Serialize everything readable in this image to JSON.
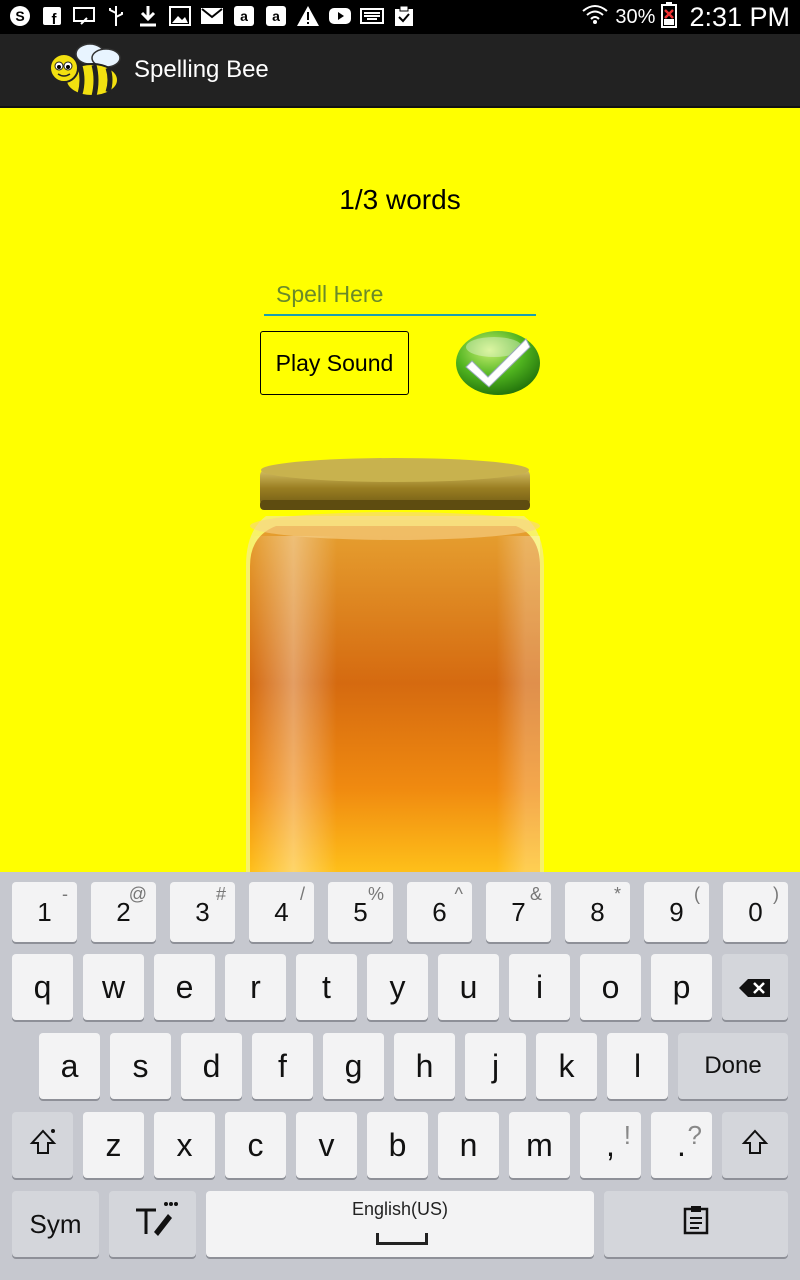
{
  "status_bar": {
    "icons": [
      "skype-icon",
      "facebook-icon",
      "cast-icon",
      "usb-icon",
      "download-icon",
      "gallery-icon",
      "gmail-icon",
      "amazon-icon",
      "amazon-icon",
      "warning-icon",
      "youtube-icon",
      "keyboard-icon",
      "clipboard-check-icon"
    ],
    "battery_percent": "30%",
    "time": "2:31 PM"
  },
  "app_bar": {
    "title": "Spelling Bee",
    "logo": "bee-logo"
  },
  "main": {
    "background": "#ffff00",
    "progress_text": "1/3 words",
    "spell_placeholder": "Spell Here",
    "spell_value": "",
    "play_button_label": "Play Sound",
    "check_icon": "check-icon",
    "image": "honey-jar"
  },
  "keyboard": {
    "number_row": [
      {
        "main": "1",
        "sub": "-"
      },
      {
        "main": "2",
        "sub": "@"
      },
      {
        "main": "3",
        "sub": "#"
      },
      {
        "main": "4",
        "sub": "/"
      },
      {
        "main": "5",
        "sub": "%"
      },
      {
        "main": "6",
        "sub": "^"
      },
      {
        "main": "7",
        "sub": "&"
      },
      {
        "main": "8",
        "sub": "*"
      },
      {
        "main": "9",
        "sub": "("
      },
      {
        "main": "0",
        "sub": ")"
      }
    ],
    "row1": [
      "q",
      "w",
      "e",
      "r",
      "t",
      "y",
      "u",
      "i",
      "o",
      "p"
    ],
    "row2": [
      "a",
      "s",
      "d",
      "f",
      "g",
      "h",
      "j",
      "k",
      "l"
    ],
    "done_label": "Done",
    "row3": [
      "z",
      "x",
      "c",
      "v",
      "b",
      "n",
      "m"
    ],
    "comma": {
      "main": ",",
      "sub": "!"
    },
    "period": {
      "main": ".",
      "sub": "?"
    },
    "sym_label": "Sym",
    "language_label": "English(US)"
  }
}
